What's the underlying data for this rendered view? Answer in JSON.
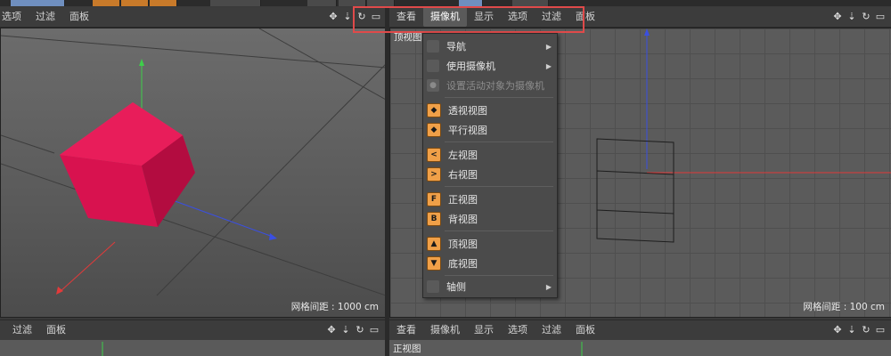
{
  "left_viewport": {
    "menu": [
      "选项",
      "过滤",
      "面板"
    ],
    "grid_spacing": "网格间距 : 1000 cm",
    "cube_color": "#d8124f"
  },
  "right_viewport": {
    "menu": [
      "查看",
      "摄像机",
      "显示",
      "选项",
      "过滤",
      "面板"
    ],
    "active_menu": "摄像机",
    "view_name": "顶视图",
    "grid_spacing": "网格间距 : 100 cm"
  },
  "bottom_left": {
    "menu": [
      "过滤",
      "面板"
    ]
  },
  "bottom_right": {
    "menu": [
      "查看",
      "摄像机",
      "显示",
      "选项",
      "过滤",
      "面板"
    ],
    "view_name": "正视图"
  },
  "camera_menu": {
    "items": [
      {
        "label": "导航",
        "icon": "none",
        "submenu": true
      },
      {
        "label": "使用摄像机",
        "icon": "none",
        "submenu": true
      },
      {
        "label": "设置活动对象为摄像机",
        "icon": "camera-gray",
        "disabled": true
      },
      {
        "label": "透视视图",
        "icon": "cube"
      },
      {
        "label": "平行视图",
        "icon": "cube"
      },
      {
        "label": "左视图",
        "icon": "arrow-left"
      },
      {
        "label": "右视图",
        "icon": "arrow-right"
      },
      {
        "label": "正视图",
        "icon": "F"
      },
      {
        "label": "背视图",
        "icon": "B"
      },
      {
        "label": "顶视图",
        "icon": "arrow-up"
      },
      {
        "label": "底视图",
        "icon": "arrow-down"
      },
      {
        "label": "轴侧",
        "icon": "none",
        "submenu": true
      }
    ]
  },
  "colors": {
    "highlight": "#e04a4a",
    "axis_red": "#e23a3a",
    "axis_green": "#3ecf4a",
    "axis_blue": "#3a4fe2",
    "icon_orange": "#f0a048"
  }
}
